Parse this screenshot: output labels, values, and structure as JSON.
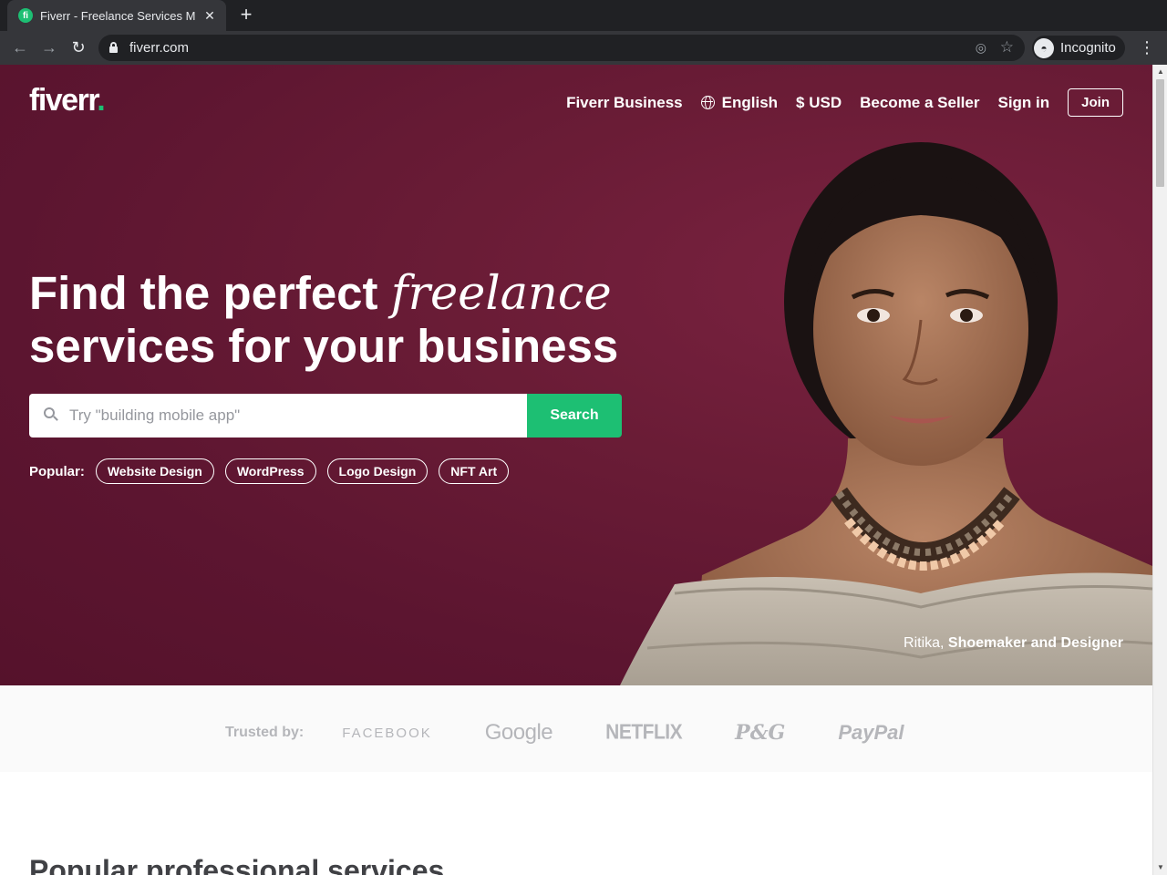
{
  "browser": {
    "tab_title": "Fiverr - Freelance Services Marketplace",
    "tab_favicon": "fi",
    "url": "fiverr.com",
    "profile_label": "Incognito"
  },
  "header": {
    "logo": "fiverr",
    "logo_dot": ".",
    "nav": {
      "business": "Fiverr Business",
      "language": "English",
      "currency": "$ USD",
      "become_seller": "Become a Seller",
      "sign_in": "Sign in",
      "join": "Join"
    }
  },
  "hero": {
    "headline_line1_start": "Find the perfect ",
    "headline_line1_em": "freelance",
    "headline_line2": "services for your business",
    "search_placeholder": "Try \"building mobile app\"",
    "search_button": "Search",
    "popular_label": "Popular:",
    "popular_tags": [
      "Website Design",
      "WordPress",
      "Logo Design",
      "NFT Art"
    ],
    "caption_name": "Ritika,",
    "caption_role": "Shoemaker and Designer"
  },
  "trusted": {
    "label": "Trusted by:",
    "brands": [
      "FACEBOOK",
      "Google",
      "NETFLIX",
      "P&G",
      "PayPal"
    ]
  },
  "sections": {
    "popular_services_title": "Popular professional services"
  },
  "colors": {
    "brand_green": "#1dbf73",
    "hero_bg": "#5c1530",
    "chrome_dark": "#202124"
  }
}
